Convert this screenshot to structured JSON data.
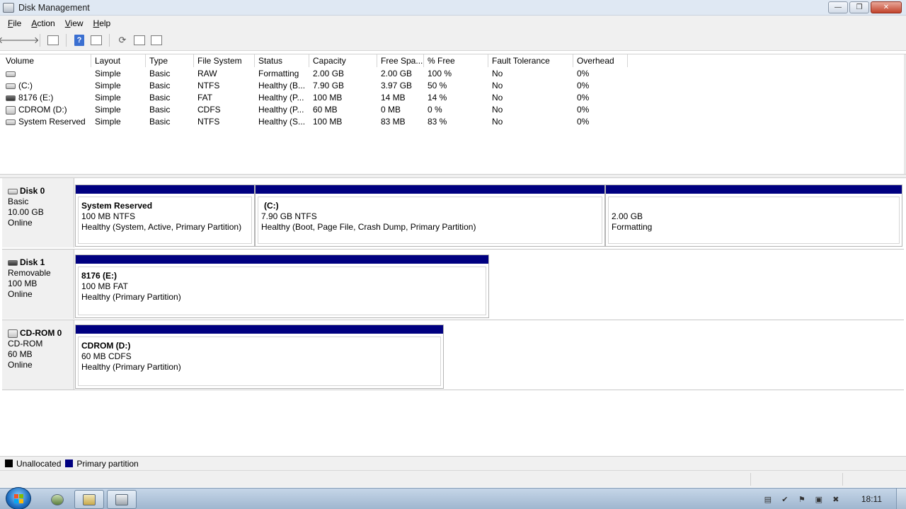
{
  "window": {
    "title": "Disk Management",
    "controls": {
      "minimize": "—",
      "maximize": "❐",
      "close": "✕"
    }
  },
  "menu": [
    {
      "accel": "F",
      "rest": "ile"
    },
    {
      "accel": "A",
      "rest": "ction"
    },
    {
      "accel": "V",
      "rest": "iew"
    },
    {
      "accel": "H",
      "rest": "elp"
    }
  ],
  "toolbar": {
    "back_icon": "🡐",
    "forward_icon": "🡒",
    "help_label": "?",
    "refresh_icon": "⟳"
  },
  "volume_table": {
    "headers": [
      "Volume",
      "Layout",
      "Type",
      "File System",
      "Status",
      "Capacity",
      "Free Spa...",
      "% Free",
      "Fault Tolerance",
      "Overhead"
    ],
    "rows": [
      {
        "volume": "",
        "layout": "Simple",
        "type": "Basic",
        "fs": "RAW",
        "status": "Formatting",
        "capacity": "2.00 GB",
        "free": "2.00 GB",
        "pct_free": "100 %",
        "fault": "No",
        "overhead": "0%",
        "icon": "drive"
      },
      {
        "volume": "(C:)",
        "layout": "Simple",
        "type": "Basic",
        "fs": "NTFS",
        "status": "Healthy (B...",
        "capacity": "7.90 GB",
        "free": "3.97 GB",
        "pct_free": "50 %",
        "fault": "No",
        "overhead": "0%",
        "icon": "drive"
      },
      {
        "volume": "8176 (E:)",
        "layout": "Simple",
        "type": "Basic",
        "fs": "FAT",
        "status": "Healthy (P...",
        "capacity": "100 MB",
        "free": "14 MB",
        "pct_free": "14 %",
        "fault": "No",
        "overhead": "0%",
        "icon": "removable"
      },
      {
        "volume": "CDROM (D:)",
        "layout": "Simple",
        "type": "Basic",
        "fs": "CDFS",
        "status": "Healthy (P...",
        "capacity": "60 MB",
        "free": "0 MB",
        "pct_free": "0 %",
        "fault": "No",
        "overhead": "0%",
        "icon": "cdrom"
      },
      {
        "volume": "System Reserved",
        "layout": "Simple",
        "type": "Basic",
        "fs": "NTFS",
        "status": "Healthy (S...",
        "capacity": "100 MB",
        "free": "83 MB",
        "pct_free": "83 %",
        "fault": "No",
        "overhead": "0%",
        "icon": "drive"
      }
    ]
  },
  "disks": [
    {
      "name": "Disk 0",
      "kind": "Basic",
      "size": "10.00 GB",
      "state": "Online",
      "partitions": [
        {
          "name": "System Reserved",
          "size_fs": "100 MB NTFS",
          "status": "Healthy (System, Active, Primary Partition)"
        },
        {
          "name": "(C:)",
          "size_fs": "7.90 GB NTFS",
          "status": "Healthy (Boot, Page File, Crash Dump, Primary Partition)"
        },
        {
          "name": "",
          "size_fs": "2.00 GB",
          "status": "Formatting"
        }
      ]
    },
    {
      "name": "Disk 1",
      "kind": "Removable",
      "size": "100 MB",
      "state": "Online",
      "partitions": [
        {
          "name": "8176  (E:)",
          "size_fs": "100 MB FAT",
          "status": "Healthy (Primary Partition)"
        }
      ]
    },
    {
      "name": "CD-ROM 0",
      "kind": "CD-ROM",
      "size": "60 MB",
      "state": "Online",
      "partitions": [
        {
          "name": "CDROM  (D:)",
          "size_fs": "60 MB CDFS",
          "status": "Healthy (Primary Partition)"
        }
      ]
    }
  ],
  "legend": [
    {
      "label": "Unallocated",
      "color": "#000000"
    },
    {
      "label": "Primary partition",
      "color": "#000080"
    }
  ],
  "colors": {
    "partition_bar": "#000080"
  },
  "taskbar": {
    "clock": "18:11",
    "tray_icons": [
      "document-icon",
      "network-check-icon",
      "flag-icon",
      "network-icon",
      "volume-muted-icon"
    ]
  }
}
